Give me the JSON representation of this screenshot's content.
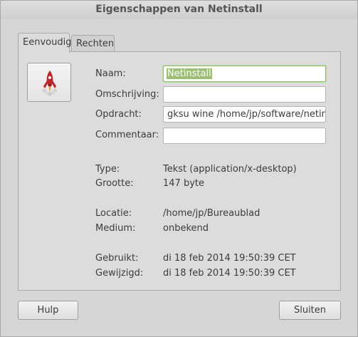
{
  "window": {
    "title": "Eigenschappen van Netinstall"
  },
  "tabs": [
    {
      "label": "Eenvoudig",
      "active": true
    },
    {
      "label": "Rechten",
      "active": false
    }
  ],
  "icon": {
    "name": "rocket-icon",
    "color": "#c0262c"
  },
  "form": {
    "name_label": "Naam:",
    "name_value": "Netinstall",
    "description_label": "Omschrijving:",
    "description_value": "",
    "command_label": "Opdracht:",
    "command_value": "gksu wine /home/jp/software/netinst",
    "comment_label": "Commentaar:",
    "comment_value": ""
  },
  "info": {
    "type_label": "Type:",
    "type_value": "Tekst (application/x-desktop)",
    "size_label": "Grootte:",
    "size_value": "147 byte",
    "location_label": "Locatie:",
    "location_value": "/home/jp/Bureaublad",
    "medium_label": "Medium:",
    "medium_value": "onbekend",
    "used_label": "Gebruikt:",
    "used_value": "di 18 feb 2014 19:50:39 CET",
    "modified_label": "Gewijzigd:",
    "modified_value": "di 18 feb 2014 19:50:39 CET"
  },
  "buttons": {
    "help_label": "Hulp",
    "close_label": "Sluiten"
  },
  "colors": {
    "focus_border": "#8fbf6b",
    "selection": "#9cbf75"
  }
}
